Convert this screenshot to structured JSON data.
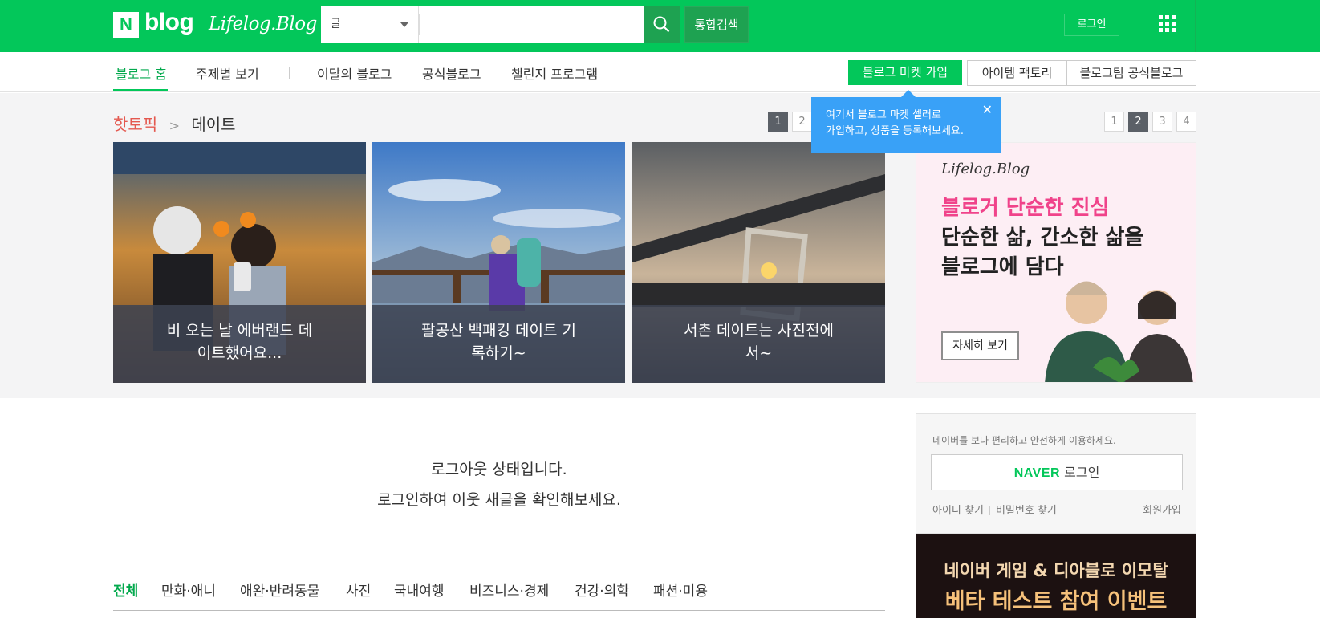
{
  "header": {
    "logo_n": "N",
    "logo_blog": "blog",
    "logo_lifelog": "Lifelog.Blog",
    "search_category": "글",
    "search_placeholder": "",
    "integrated_search": "통합검색",
    "login": "로그인",
    "brand_color": "#03c75a"
  },
  "subnav": {
    "items": [
      "블로그 홈",
      "주제별 보기",
      "이달의 블로그",
      "공식블로그",
      "챌린지 프로그램"
    ],
    "active_index": 0,
    "market_join": "블로그 마켓 가입",
    "item_factory": "아이템 팩토리",
    "official_team": "블로그팀 공식블로그"
  },
  "tooltip": {
    "line1": "여기서 블로그 마켓 셀러로",
    "line2": "가입하고, 상품을 등록해보세요.",
    "close": "✕"
  },
  "hot_topic": {
    "label": "핫토픽",
    "chevron": ">",
    "topic": "데이트",
    "pager_left": [
      "1",
      "2"
    ],
    "pager_left_active": 0,
    "pager_right": [
      "1",
      "2",
      "3",
      "4"
    ],
    "pager_right_active": 1,
    "cards": [
      {
        "caption_l1": "비 오는 날 에버랜드 데",
        "caption_l2": "이트했어요..."
      },
      {
        "caption_l1": "팔공산 백패킹 데이트 기",
        "caption_l2": "록하기~"
      },
      {
        "caption_l1": "서촌 데이트는 사진전에",
        "caption_l2": "서~"
      }
    ]
  },
  "ad": {
    "logo": "Lifelog.Blog",
    "line1": "블로거 단순한 진심",
    "line2": "단순한 삶, 간소한 삶을",
    "line3": "블로그에 담다",
    "button": "자세히 보기"
  },
  "main": {
    "logout_line1": "로그아웃 상태입니다.",
    "logout_line2": "로그인하여 이웃 새글을 확인해보세요.",
    "categories": [
      "전체",
      "만화·애니",
      "애완·반려동물",
      "사진",
      "국내여행",
      "비즈니스·경제",
      "건강·의학",
      "패션·미용"
    ]
  },
  "login_box": {
    "desc": "네이버를 보다 편리하고 안전하게 이용하세요.",
    "naver": "NAVER",
    "login": "로그인",
    "find_id": "아이디 찾기",
    "find_pw": "비밀번호 찾기",
    "join": "회원가입"
  },
  "game_banner": {
    "line1": "네이버 게임 & 디아블로 이모탈",
    "line2": "베타 테스트 참여 이벤트"
  }
}
